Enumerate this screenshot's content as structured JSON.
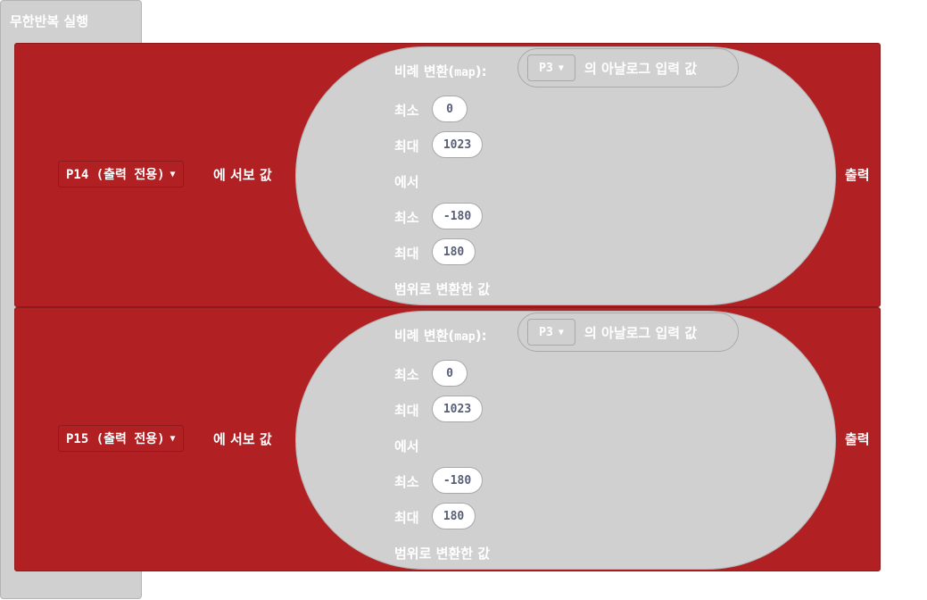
{
  "forever": {
    "label": "무한반복 실행"
  },
  "blocks": [
    {
      "pin": "P14 (출력 전용)",
      "servo_label": "에 서보 값",
      "output_label": "출력",
      "map": {
        "label_prefix": "비례 변환(",
        "label_code": "map",
        "label_suffix": "):",
        "analog_pin": "P3",
        "analog_label": "의 아날로그 입력 값",
        "min_label_1": "최소",
        "from_low": "0",
        "max_label_1": "최대",
        "from_high": "1023",
        "from_text": "에서",
        "min_label_2": "최소",
        "to_low": "-180",
        "max_label_2": "최대",
        "to_high": "180",
        "range_text": "범위로 변환한 값"
      }
    },
    {
      "pin": "P15 (출력 전용)",
      "servo_label": "에 서보 값",
      "output_label": "출력",
      "map": {
        "label_prefix": "비례 변환(",
        "label_code": "map",
        "label_suffix": "):",
        "analog_pin": "P3",
        "analog_label": "의 아날로그 입력 값",
        "min_label_1": "최소",
        "from_low": "0",
        "max_label_1": "최대",
        "from_high": "1023",
        "from_text": "에서",
        "min_label_2": "최소",
        "to_low": "-180",
        "max_label_2": "최대",
        "to_high": "180",
        "range_text": "범위로 변환한 값"
      }
    }
  ],
  "colors": {
    "servo_block": "#b12022",
    "map_block": "#d0d0d0",
    "number_text": "#575e75"
  },
  "icons": {
    "dropdown": "triangle-down-icon"
  }
}
